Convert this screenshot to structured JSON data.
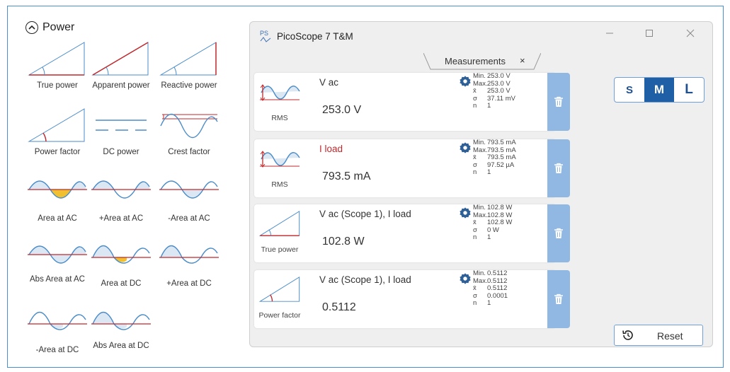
{
  "palette": {
    "header": "Power",
    "tiles": [
      {
        "label": "True power",
        "icon": "true-power-icon"
      },
      {
        "label": "Apparent power",
        "icon": "apparent-power-icon"
      },
      {
        "label": "Reactive power",
        "icon": "reactive-power-icon"
      },
      {
        "label": "Power factor",
        "icon": "power-factor-icon"
      },
      {
        "label": "DC power",
        "icon": "dc-power-icon"
      },
      {
        "label": "Crest factor",
        "icon": "crest-factor-icon"
      },
      {
        "label": "Area at AC",
        "icon": "area-ac-icon"
      },
      {
        "label": "+Area at AC",
        "icon": "plus-area-ac-icon"
      },
      {
        "label": "-Area at AC",
        "icon": "minus-area-ac-icon"
      },
      {
        "label": "Abs Area at AC",
        "icon": "abs-area-ac-icon"
      },
      {
        "label": "Area at DC",
        "icon": "area-dc-icon"
      },
      {
        "label": "+Area at DC",
        "icon": "plus-area-dc-icon"
      },
      {
        "label": "-Area at DC",
        "icon": "minus-area-dc-icon"
      },
      {
        "label": "Abs Area at DC",
        "icon": "abs-area-dc-icon"
      }
    ]
  },
  "window": {
    "title": "PicoScope 7 T&M",
    "app_icon_text": "PS",
    "tab_label": "Measurements",
    "tab_close": "×"
  },
  "measurements": [
    {
      "name": "V ac",
      "thumb_label": "RMS",
      "value": "253.0 V",
      "stats": [
        [
          "Min.",
          "253.0 V"
        ],
        [
          "Max.",
          "253.0 V"
        ],
        [
          "x̄",
          "253.0 V"
        ],
        [
          "σ",
          "37.11 mV"
        ],
        [
          "n",
          "1"
        ]
      ]
    },
    {
      "name": "I load",
      "thumb_label": "RMS",
      "value": "793.5 mA",
      "stats": [
        [
          "Min.",
          "793.5 mA"
        ],
        [
          "Max.",
          "793.5 mA"
        ],
        [
          "x̄",
          "793.5 mA"
        ],
        [
          "σ",
          "97.52 µA"
        ],
        [
          "n",
          "1"
        ]
      ]
    },
    {
      "name": "V ac (Scope 1), I load",
      "thumb_label": "True power",
      "value": "102.8 W",
      "stats": [
        [
          "Min.",
          "102.8 W"
        ],
        [
          "Max.",
          "102.8 W"
        ],
        [
          "x̄",
          "102.8 W"
        ],
        [
          "σ",
          "0 W"
        ],
        [
          "n",
          "1"
        ]
      ]
    },
    {
      "name": "V ac (Scope 1), I load",
      "thumb_label": "Power factor",
      "value": "0.5112",
      "stats": [
        [
          "Min.",
          "0.5112"
        ],
        [
          "Max.",
          "0.5112"
        ],
        [
          "x̄",
          "0.5112"
        ],
        [
          "σ",
          "0.0001"
        ],
        [
          "n",
          "1"
        ]
      ]
    }
  ],
  "size_toggle": {
    "s": "S",
    "m": "M",
    "l": "L",
    "selected": "M"
  },
  "reset_label": "Reset",
  "colors": {
    "accent": "#1f5fa5",
    "trash": "#90b8e3",
    "red": "#c0282b",
    "wave": "#4a8cc8",
    "fill": "#f0c030"
  }
}
